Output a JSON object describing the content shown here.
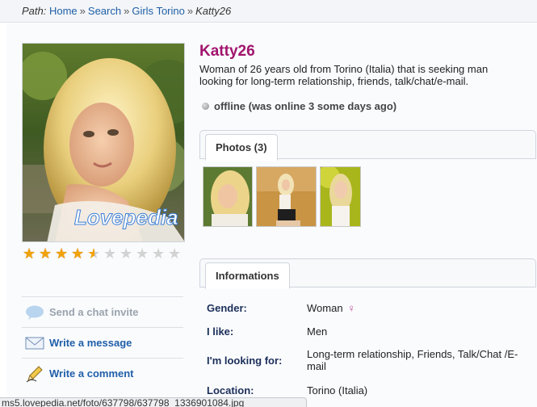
{
  "breadcrumb": {
    "prefix": "Path:",
    "items": [
      "Home",
      "Search",
      "Girls Torino"
    ],
    "current": "Katty26",
    "separator": "»"
  },
  "profile": {
    "name": "Katty26",
    "description": "Woman of 26 years old from Torino (Italia) that is seeking man looking for long-term relationship, friends, talk/chat/e-mail.",
    "status": "offline (was online 3 some days ago)",
    "watermark": "Lovepedia",
    "rating": {
      "value": 4.5,
      "max": 10
    }
  },
  "actions": [
    {
      "label": "Send a chat invite",
      "icon": "chat-bubble-icon",
      "enabled": false
    },
    {
      "label": "Write a message",
      "icon": "envelope-icon",
      "enabled": true
    },
    {
      "label": "Write a comment",
      "icon": "pencil-icon",
      "enabled": true
    }
  ],
  "photos_tab": {
    "label": "Photos (3)"
  },
  "info_tab": {
    "label": "Informations"
  },
  "info": {
    "gender_label": "Gender:",
    "gender": "Woman",
    "like_label": "I like:",
    "like": "Men",
    "looking_label": "I'm looking for:",
    "looking": "Long-term relationship, Friends, Talk/Chat /E-mail",
    "location_label": "Location:",
    "location": "Torino (Italia)"
  },
  "status_bar": "ms5.lovepedia.net/foto/637798/637798_1336901084.jpg",
  "colors": {
    "name": "#a1146d",
    "link": "#1f5fa8",
    "star": "#f1a20b"
  }
}
